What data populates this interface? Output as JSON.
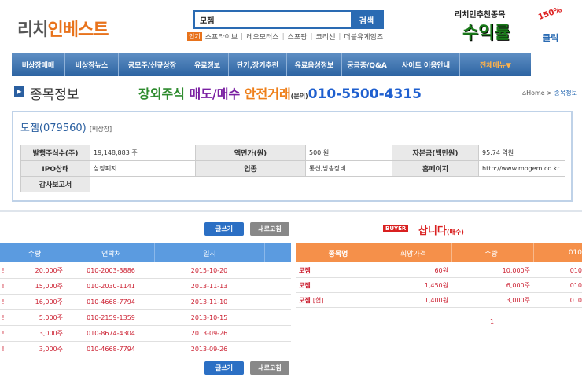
{
  "header": {
    "logo_part1": "리치",
    "logo_part2": "인베스트",
    "search_value": "모젬",
    "search_button": "검색",
    "popular_label": "인기",
    "popular_items": [
      "스프라이브",
      "레오모터스",
      "스포팡",
      "코리센",
      "더블유게임즈"
    ],
    "ad_title": "리치인추천종목",
    "ad_big": "수익률",
    "ad_pct": "150%",
    "ad_click": "클릭"
  },
  "nav": {
    "items": [
      "비상장매매",
      "비상장뉴스",
      "공모주/신규상장",
      "유료정보",
      "단기,장기추천",
      "유료음성정보",
      "궁금증/Q&A",
      "사이트 이용안내",
      "전체메뉴▼"
    ]
  },
  "page": {
    "title": "종목정보",
    "promo_a": "장외주식",
    "promo_b": "매도/매수",
    "promo_c": "안전거래",
    "promo_small": "(문의)",
    "promo_phone": "010-5500-4315",
    "crumb_home": "Home",
    "crumb_current": "종목정보"
  },
  "stock": {
    "name": "모젬(079560)",
    "status": "[비상장]",
    "rows": [
      [
        "발행주식수(주)",
        "19,148,883 주",
        "액면가(원)",
        "500 원",
        "자본금(백만원)",
        "95.74 억원"
      ],
      [
        "IPO상태",
        "상장폐지",
        "업종",
        "통신,방송장비",
        "홈페이지",
        "http://www.mogem.co.kr"
      ],
      [
        "감사보고서",
        "",
        "",
        "",
        "",
        ""
      ]
    ]
  },
  "buttons": {
    "write": "글쓰기",
    "refresh": "새로고침"
  },
  "sell": {
    "headers": [
      "수량",
      "연락처",
      "일시"
    ],
    "rows": [
      {
        "qty": "20,000주",
        "contact": "010-2003-3886",
        "date": "2015-10-20"
      },
      {
        "qty": "15,000주",
        "contact": "010-2030-1141",
        "date": "2013-11-13"
      },
      {
        "qty": "16,000주",
        "contact": "010-4668-7794",
        "date": "2013-11-10"
      },
      {
        "qty": "5,000주",
        "contact": "010-2159-1359",
        "date": "2013-10-15"
      },
      {
        "qty": "3,000주",
        "contact": "010-8674-4304",
        "date": "2013-09-26"
      },
      {
        "qty": "3,000주",
        "contact": "010-4668-7794",
        "date": "2013-09-26"
      }
    ]
  },
  "buy": {
    "badge": "BUYER",
    "title": "삽니다",
    "title_small": "(매수)",
    "headers": [
      "종목명",
      "희망가격",
      "수량",
      "010"
    ],
    "rows": [
      {
        "name": "모젬",
        "tag": "",
        "price": "60원",
        "qty": "10,000주",
        "contact": "010"
      },
      {
        "name": "모젬",
        "tag": "",
        "price": "1,450원",
        "qty": "6,000주",
        "contact": "010"
      },
      {
        "name": "모젬",
        "tag": "[협]",
        "price": "1,400원",
        "qty": "3,000주",
        "contact": "010"
      }
    ],
    "page": "1"
  }
}
